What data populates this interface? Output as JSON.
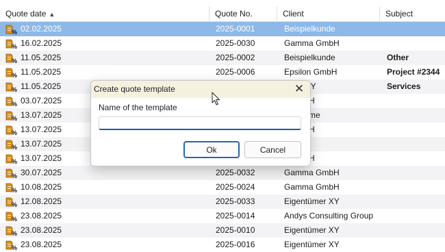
{
  "header": {
    "columns": [
      {
        "label": "Quote date",
        "sorted": "ascending"
      },
      {
        "label": "Quote No."
      },
      {
        "label": "Client"
      },
      {
        "label": "Subject"
      }
    ]
  },
  "rows": [
    {
      "date": "02.02.2025",
      "no": "2025-0001",
      "client": "Beispielkunde",
      "subject": "",
      "selected": true
    },
    {
      "date": "16.02.2025",
      "no": "2025-0030",
      "client": "Gamma GmbH",
      "subject": ""
    },
    {
      "date": "11.05.2025",
      "no": "2025-0002",
      "client": "Beispielkunde",
      "subject": "Other"
    },
    {
      "date": "11.05.2025",
      "no": "2025-0006",
      "client": "Epsilon GmbH",
      "subject": "Project #2344"
    },
    {
      "date": "11.05.2025",
      "no": "",
      "client": "ümer XY",
      "subject": "Services"
    },
    {
      "date": "03.07.2025",
      "no": "",
      "client": "a GmbH",
      "subject": ""
    },
    {
      "date": "13.07.2025",
      "no": "",
      "client": "ktenname",
      "subject": ""
    },
    {
      "date": "13.07.2025",
      "no": "",
      "client": "a GmbH",
      "subject": ""
    },
    {
      "date": "13.07.2025",
      "no": "",
      "client": "lkunde",
      "subject": ""
    },
    {
      "date": "13.07.2025",
      "no": "",
      "client": "a GmbH",
      "subject": ""
    },
    {
      "date": "30.07.2025",
      "no": "2025-0032",
      "client": "Gamma GmbH",
      "subject": ""
    },
    {
      "date": "10.08.2025",
      "no": "2025-0024",
      "client": "Gamma GmbH",
      "subject": ""
    },
    {
      "date": "12.08.2025",
      "no": "2025-0033",
      "client": "Eigentümer XY",
      "subject": ""
    },
    {
      "date": "23.08.2025",
      "no": "2025-0014",
      "client": "Andys Consulting Group",
      "subject": ""
    },
    {
      "date": "23.08.2025",
      "no": "2025-0010",
      "client": "Eigentümer XY",
      "subject": ""
    },
    {
      "date": "23.08.2025",
      "no": "2025-0016",
      "client": "Eigentümer XY",
      "subject": ""
    }
  ],
  "row_icon": "quote-document-icon",
  "dialog": {
    "title": "Create quote template",
    "field_label": "Name of the template",
    "field_value": "",
    "field_placeholder": "",
    "ok_label": "Ok",
    "cancel_label": "Cancel",
    "close_icon": "close-icon"
  },
  "colors": {
    "selected_row": "#8db8e8",
    "alt_row": "#f3f3f5",
    "dialog_title_bg": "#f6f1df",
    "accent": "#2a62b0"
  }
}
